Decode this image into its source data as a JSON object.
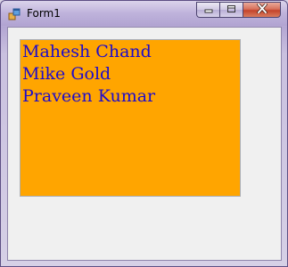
{
  "window": {
    "title": "Form1",
    "icon": "form-app-icon",
    "caption_buttons": [
      "minimize-icon",
      "maximize-icon",
      "close-icon"
    ]
  },
  "listbox": {
    "background_color": "#FFA500",
    "text_color": "#1D0BCC",
    "items": [
      "Mahesh Chand",
      "Mike Gold",
      "Praveen Kumar"
    ]
  }
}
